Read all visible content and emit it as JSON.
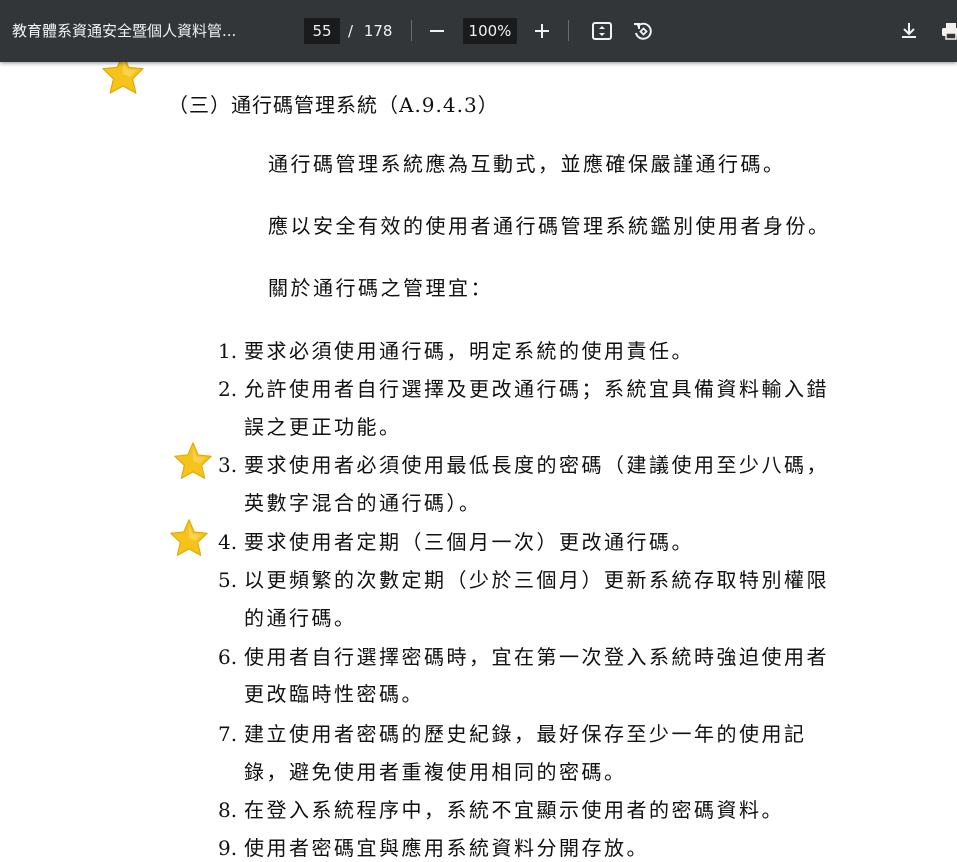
{
  "toolbar": {
    "title": "教育體系資通安全暨個人資料管...",
    "current_page": "55",
    "page_separator": "/",
    "total_pages": "178",
    "zoom": "100%",
    "icons": [
      "zoom-out-icon",
      "zoom-in-icon",
      "fit-page-icon",
      "rotate-icon",
      "download-icon",
      "print-icon"
    ]
  },
  "document": {
    "heading": "（三）通行碼管理系統（A.9.4.3）",
    "paragraphs": [
      "通行碼管理系統應為互動式，並應確保嚴謹通行碼。",
      "應以安全有效的使用者通行碼管理系統鑑別使用者身份。",
      "關於通行碼之管理宜："
    ],
    "items": [
      {
        "num": "1.",
        "lines": [
          "要求必須使用通行碼，明定系統的使用責任。"
        ]
      },
      {
        "num": "2.",
        "lines": [
          "允許使用者自行選擇及更改通行碼；系統宜具備資料輸入錯",
          "誤之更正功能。"
        ]
      },
      {
        "num": "3.",
        "lines": [
          "要求使用者必須使用最低長度的密碼（建議使用至少八碼，",
          "英數字混合的通行碼）。"
        ]
      },
      {
        "num": "4.",
        "lines": [
          "要求使用者定期（三個月一次）更改通行碼。"
        ]
      },
      {
        "num": "5.",
        "lines": [
          "以更頻繁的次數定期（少於三個月）更新系統存取特別權限",
          "的通行碼。"
        ]
      },
      {
        "num": "6.",
        "lines": [
          "使用者自行選擇密碼時，宜在第一次登入系統時強迫使用者",
          "更改臨時性密碼。"
        ]
      },
      {
        "num": "7.",
        "lines": [
          "建立使用者密碼的歷史紀錄，最好保存至少一年的使用記",
          "錄，避免使用者重複使用相同的密碼。"
        ]
      },
      {
        "num": "8.",
        "lines": [
          "在登入系統程序中，系統不宜顯示使用者的密碼資料。"
        ]
      },
      {
        "num": "9.",
        "lines": [
          "使用者密碼宜與應用系統資料分開存放。"
        ]
      }
    ]
  },
  "colors": {
    "toolbar_bg": "#323639",
    "input_bg": "#191b1c",
    "text": "#111111",
    "star": "#f6c21c"
  }
}
